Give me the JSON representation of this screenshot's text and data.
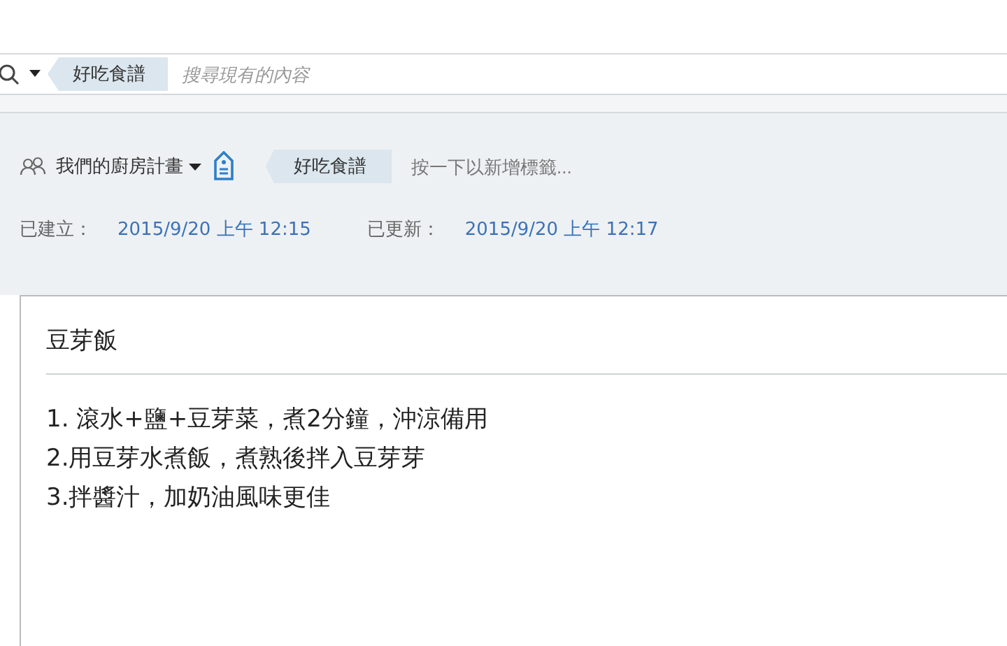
{
  "search": {
    "scope_tag": "好吃食譜",
    "placeholder": "搜尋現有的內容"
  },
  "note_header": {
    "notebook": "我們的廚房計畫",
    "tags": [
      "好吃食譜"
    ],
    "tag_placeholder": "按一下以新增標籤...",
    "created_label": "已建立：",
    "created": "2015/9/20 上午 12:15",
    "updated_label": "已更新：",
    "updated": "2015/9/20 上午 12:17"
  },
  "note": {
    "title": "豆芽飯",
    "lines": [
      "1. 滾水+鹽+豆芽菜，煮2分鐘，沖涼備用",
      "2.用豆芽水煮飯，煮熟後拌入豆芽芽",
      "3.拌醬汁，加奶油風味更佳"
    ]
  }
}
